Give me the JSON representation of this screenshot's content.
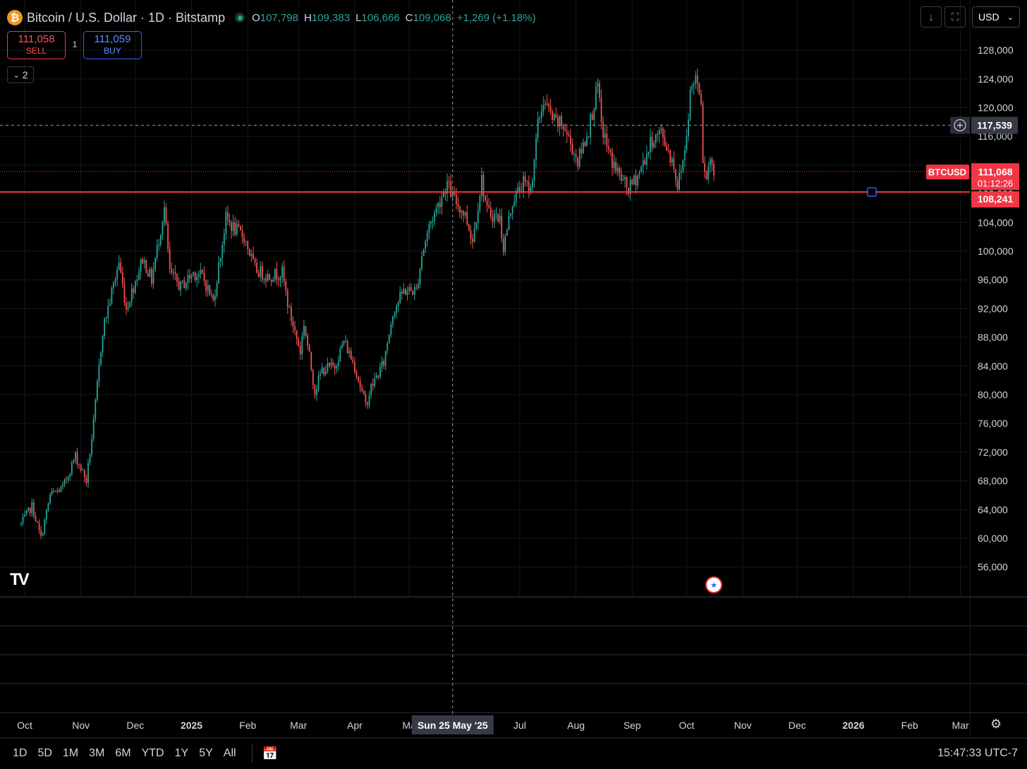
{
  "header": {
    "coin_symbol": "₿",
    "title": "Bitcoin / U.S. Dollar · 1D · Bitstamp",
    "ohlc": [
      {
        "label": "O",
        "value": "107,798"
      },
      {
        "label": "H",
        "value": "109,383"
      },
      {
        "label": "L",
        "value": "106,666"
      },
      {
        "label": "C",
        "value": "109,068"
      }
    ],
    "change": "+1,269 (+1.18%)",
    "currency": "USD",
    "currency_icon": "chevron-down-icon",
    "toolbar_icons": [
      "download-icon",
      "fullscreen-icon"
    ]
  },
  "trade": {
    "sell_price": "111,058",
    "sell_label": "SELL",
    "buy_price": "111,059",
    "buy_label": "BUY",
    "spread": "1"
  },
  "collapse": {
    "count": "2",
    "icon": "chevron-down-icon"
  },
  "chart_data": {
    "type": "candlestick",
    "symbol": "BTCUSD",
    "interval": "1D",
    "y_ticks": [
      56000,
      60000,
      64000,
      68000,
      72000,
      76000,
      80000,
      84000,
      88000,
      92000,
      96000,
      100000,
      104000,
      108000,
      112000,
      116000,
      120000,
      124000,
      128000
    ],
    "y_tick_labels": [
      "56,000",
      "60,000",
      "64,000",
      "68,000",
      "72,000",
      "76,000",
      "80,000",
      "84,000",
      "88,000",
      "92,000",
      "96,000",
      "100,000",
      "104,000",
      "108,000",
      "112,000",
      "116,000",
      "120,000",
      "124,000",
      "128,000"
    ],
    "x_labels": [
      "Oct",
      "Nov",
      "Dec",
      "2025",
      "Feb",
      "Mar",
      "Apr",
      "Ma",
      "Jul",
      "Aug",
      "Sep",
      "Oct",
      "Nov",
      "Dec",
      "2026",
      "Feb",
      "Mar"
    ],
    "price_path": [
      [
        "2024-09-29",
        62000
      ],
      [
        "2024-10-05",
        64500
      ],
      [
        "2024-10-10",
        60000
      ],
      [
        "2024-10-15",
        66000
      ],
      [
        "2024-10-22",
        67000
      ],
      [
        "2024-10-29",
        71500
      ],
      [
        "2024-11-04",
        68000
      ],
      [
        "2024-11-08",
        76000
      ],
      [
        "2024-11-13",
        89000
      ],
      [
        "2024-11-22",
        98500
      ],
      [
        "2024-11-26",
        92000
      ],
      [
        "2024-12-05",
        99000
      ],
      [
        "2024-12-10",
        96000
      ],
      [
        "2024-12-17",
        106000
      ],
      [
        "2024-12-20",
        97000
      ],
      [
        "2024-12-26",
        95000
      ],
      [
        "2025-01-02",
        97000
      ],
      [
        "2025-01-07",
        96500
      ],
      [
        "2025-01-13",
        93000
      ],
      [
        "2025-01-20",
        104500
      ],
      [
        "2025-01-25",
        103000
      ],
      [
        "2025-01-30",
        102000
      ],
      [
        "2025-02-05",
        97500
      ],
      [
        "2025-02-12",
        96500
      ],
      [
        "2025-02-20",
        97000
      ],
      [
        "2025-02-24",
        91500
      ],
      [
        "2025-03-02",
        86000
      ],
      [
        "2025-03-04",
        90000
      ],
      [
        "2025-03-10",
        80500
      ],
      [
        "2025-03-14",
        83500
      ],
      [
        "2025-03-21",
        84000
      ],
      [
        "2025-03-26",
        87500
      ],
      [
        "2025-04-01",
        84000
      ],
      [
        "2025-04-07",
        78500
      ],
      [
        "2025-04-10",
        81000
      ],
      [
        "2025-04-17",
        84500
      ],
      [
        "2025-04-22",
        91500
      ],
      [
        "2025-04-28",
        94500
      ],
      [
        "2025-05-05",
        94500
      ],
      [
        "2025-05-08",
        99500
      ],
      [
        "2025-05-12",
        103500
      ],
      [
        "2025-05-22",
        109500
      ],
      [
        "2025-05-25",
        107500
      ],
      [
        "2025-06-01",
        105000
      ],
      [
        "2025-06-05",
        101500
      ],
      [
        "2025-06-10",
        110000
      ],
      [
        "2025-06-13",
        105500
      ],
      [
        "2025-06-20",
        104500
      ],
      [
        "2025-06-22",
        100500
      ],
      [
        "2025-06-27",
        107000
      ],
      [
        "2025-07-03",
        109500
      ],
      [
        "2025-07-07",
        108500
      ],
      [
        "2025-07-11",
        117500
      ],
      [
        "2025-07-14",
        121000
      ],
      [
        "2025-07-20",
        118000
      ],
      [
        "2025-07-25",
        117500
      ],
      [
        "2025-08-02",
        112500
      ],
      [
        "2025-08-08",
        117000
      ],
      [
        "2025-08-13",
        123000
      ],
      [
        "2025-08-15",
        117500
      ],
      [
        "2025-08-20",
        113000
      ],
      [
        "2025-08-25",
        110500
      ],
      [
        "2025-08-30",
        108500
      ],
      [
        "2025-09-05",
        111000
      ],
      [
        "2025-09-12",
        115500
      ],
      [
        "2025-09-17",
        116500
      ],
      [
        "2025-09-24",
        112000
      ],
      [
        "2025-09-26",
        109000
      ],
      [
        "2025-09-30",
        114000
      ],
      [
        "2025-10-03",
        122000
      ],
      [
        "2025-10-06",
        124500
      ],
      [
        "2025-10-09",
        121500
      ],
      [
        "2025-10-10",
        113000
      ],
      [
        "2025-10-12",
        110500
      ],
      [
        "2025-10-14",
        113000
      ],
      [
        "2025-10-16",
        111068
      ]
    ],
    "crosshair": {
      "date_label": "Sun 25 May '25",
      "price_label": "117,539"
    },
    "last_price": {
      "symbol": "BTCUSD",
      "price": "111,068",
      "countdown": "01:12:26"
    },
    "horizontal_line": {
      "price": "108,241",
      "color": "#f23645"
    },
    "up_color": "#26a69a",
    "down_color": "#ef5350"
  },
  "bottom_bar": {
    "ranges": [
      "1D",
      "5D",
      "1M",
      "3M",
      "6M",
      "YTD",
      "1Y",
      "5Y",
      "All"
    ],
    "goto_icon": "calendar-goto-icon",
    "clock": "15:47:33 UTC-7",
    "settings_icon": "gear-icon"
  },
  "watermark": "TV",
  "event_icon": "us-flag-icon"
}
